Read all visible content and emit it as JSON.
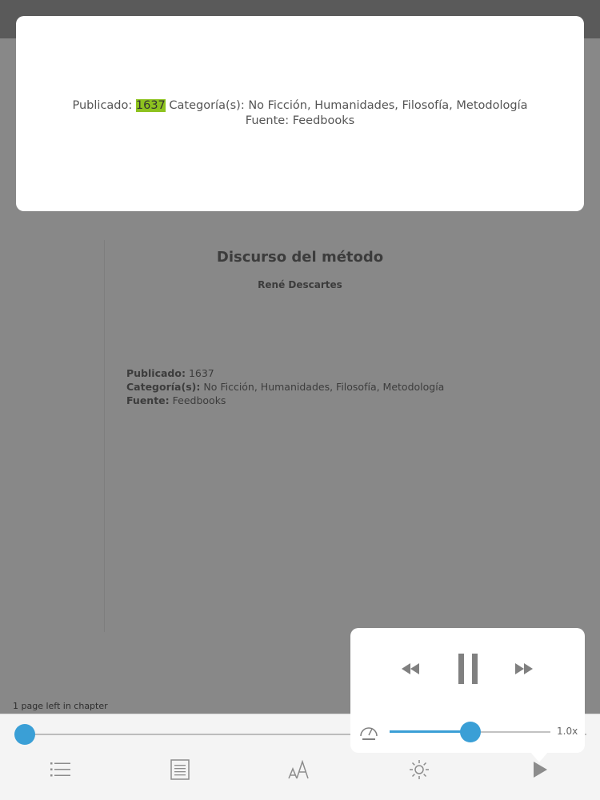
{
  "book": {
    "title": "Discurso del método",
    "author": "René Descartes",
    "meta": [
      {
        "key": "Publicado:",
        "value": "1637"
      },
      {
        "key": "Categoría(s):",
        "value": "No Ficción, Humanidades, Filosofía, Metodología"
      },
      {
        "key": "Fuente:",
        "value": "Feedbooks"
      }
    ]
  },
  "info_card": {
    "line1_prefix": "Publicado: ",
    "line1_highlight": "1637",
    "line1_suffix": " Categoría(s): No Ficción, Humanidades, Filosofía, Metodología",
    "line2": "Fuente: Feedbooks",
    "highlight_color": "#8dc21f"
  },
  "status": {
    "pages_left": "1 page left in chapter",
    "progress": 0.0
  },
  "audio": {
    "speed_label": "1.0x",
    "speed_fraction": 0.5,
    "controls": [
      "rewind-icon",
      "pause-icon",
      "fast-forward-icon"
    ]
  },
  "toolbar": {
    "icons": [
      "table-of-contents-icon",
      "notes-icon",
      "font-size-icon",
      "brightness-icon",
      "play-icon"
    ]
  },
  "colors": {
    "accent": "#3a9fd6"
  }
}
